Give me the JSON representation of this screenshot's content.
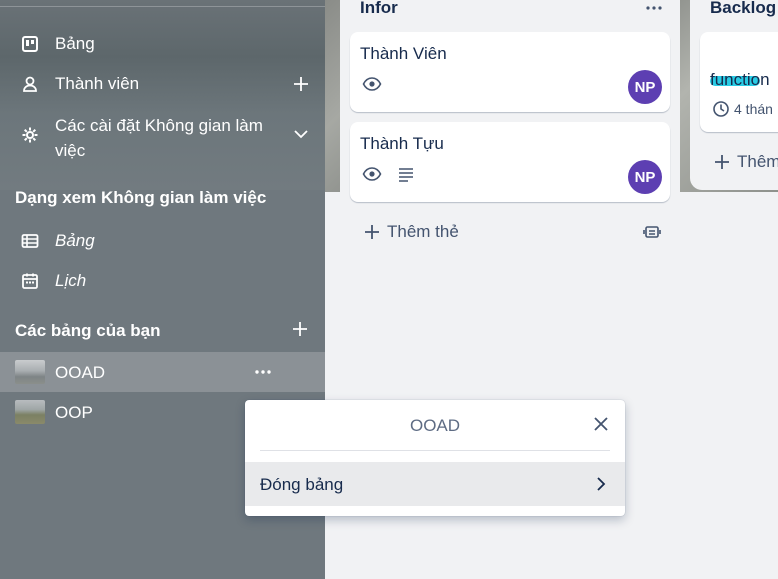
{
  "sidebar": {
    "nav": [
      {
        "label": "Bảng",
        "icon": "board-icon"
      },
      {
        "label": "Thành viên",
        "icon": "person-icon",
        "action_icon": "plus-icon"
      },
      {
        "label_line1": "Các cài đặt Không gian làm",
        "label_line2": "việc",
        "icon": "gear-icon",
        "action_icon": "chevron-down-icon"
      }
    ],
    "views_heading": "Dạng xem Không gian làm việc",
    "views": [
      {
        "label": "Bảng",
        "icon": "table-icon"
      },
      {
        "label": "Lịch",
        "icon": "calendar-icon"
      }
    ],
    "boards_heading": "Các bảng của bạn",
    "boards": [
      {
        "name": "OOAD",
        "active": true
      },
      {
        "name": "OOP",
        "active": false
      }
    ]
  },
  "lists": [
    {
      "title": "Infor",
      "cards": [
        {
          "title": "Thành Viên",
          "member": "NP",
          "badges": [
            "eye-icon"
          ]
        },
        {
          "title": "Thành Tựu",
          "member": "NP",
          "badges": [
            "eye-icon",
            "description-icon"
          ]
        }
      ],
      "add_card_label": "Thêm thẻ"
    },
    {
      "title": "Backlog",
      "cards": [
        {
          "title": "function",
          "label_color": "#29cce5",
          "due": "4 thán"
        }
      ],
      "add_card_label": "Thêm"
    }
  ],
  "popover": {
    "title": "OOAD",
    "items": [
      {
        "label": "Đóng bảng"
      }
    ]
  },
  "colors": {
    "sidebar_bg": "#6f787e",
    "active_row": "#8b9196",
    "avatar": "#5d3fb2",
    "label_cyan": "#29cce5"
  }
}
